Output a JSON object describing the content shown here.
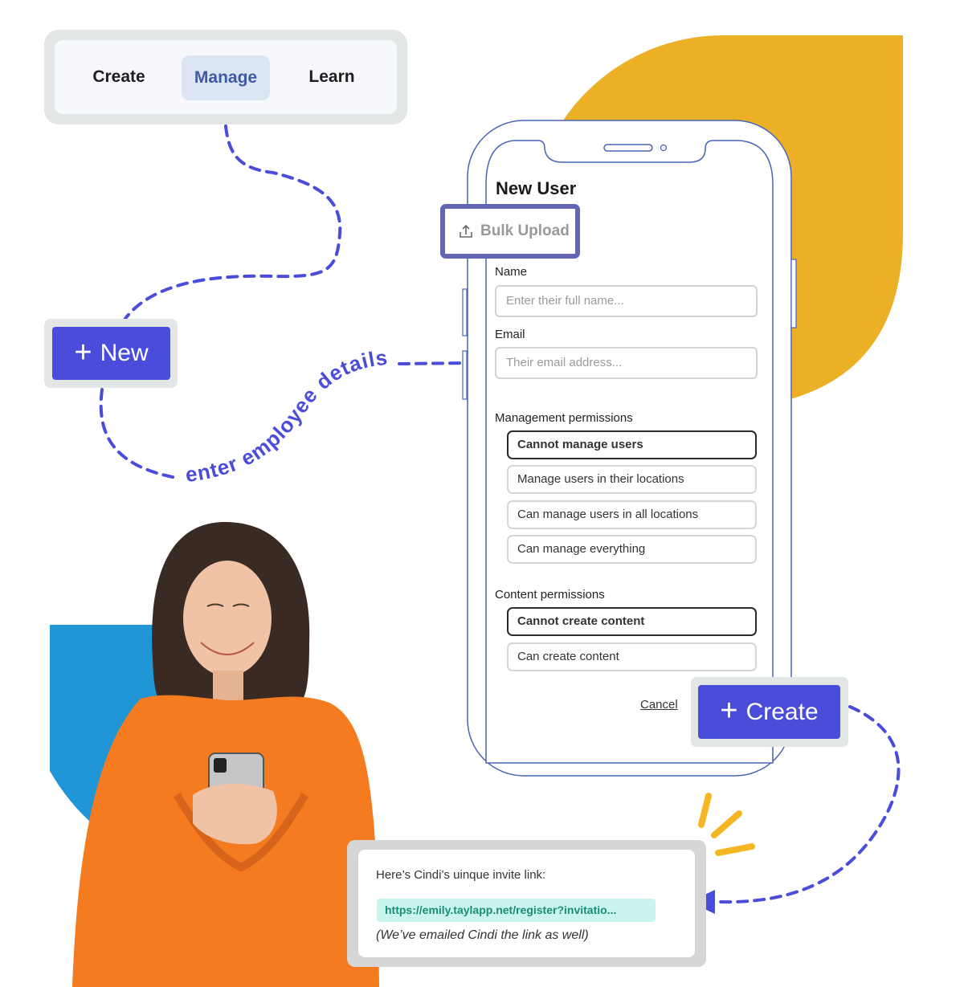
{
  "nav": {
    "tabs": [
      {
        "label": "Create",
        "active": false
      },
      {
        "label": "Manage",
        "active": true
      },
      {
        "label": "Learn",
        "active": false
      }
    ]
  },
  "new_button": {
    "icon": "plus-icon",
    "label": "New"
  },
  "annotation": {
    "text": "enter employee details"
  },
  "form": {
    "title": "New User",
    "bulk_upload": {
      "icon": "upload-icon",
      "label": "Bulk Upload"
    },
    "name": {
      "label": "Name",
      "placeholder": "Enter their full name...",
      "value": ""
    },
    "email": {
      "label": "Email",
      "placeholder": "Their email address...",
      "value": ""
    },
    "management_permissions": {
      "label": "Management permissions",
      "options": [
        {
          "label": "Cannot manage users",
          "selected": true
        },
        {
          "label": "Manage users in their locations",
          "selected": false
        },
        {
          "label": "Can manage users in all locations",
          "selected": false
        },
        {
          "label": "Can manage everything",
          "selected": false
        }
      ]
    },
    "content_permissions": {
      "label": "Content permissions",
      "options": [
        {
          "label": "Cannot create content",
          "selected": true
        },
        {
          "label": "Can create content",
          "selected": false
        }
      ]
    },
    "cancel_label": "Cancel",
    "create_button": {
      "icon": "plus-icon",
      "label": "Create"
    }
  },
  "invite": {
    "title": "Here’s Cindi’s uinque invite link:",
    "link": "https://emily.taylapp.net/register?invitatio...",
    "note": "(We’ve emailed Cindi the link as well)"
  },
  "colors": {
    "accent": "#4a4dd9",
    "highlight_border": "#6366b3",
    "yellow_shape": "#ebb026",
    "blue_shape": "#2196d6",
    "phone_outline": "#4a64b5",
    "link_bg": "#c9f5ee",
    "link_text": "#1a8d77",
    "sweater": "#f47b20"
  }
}
